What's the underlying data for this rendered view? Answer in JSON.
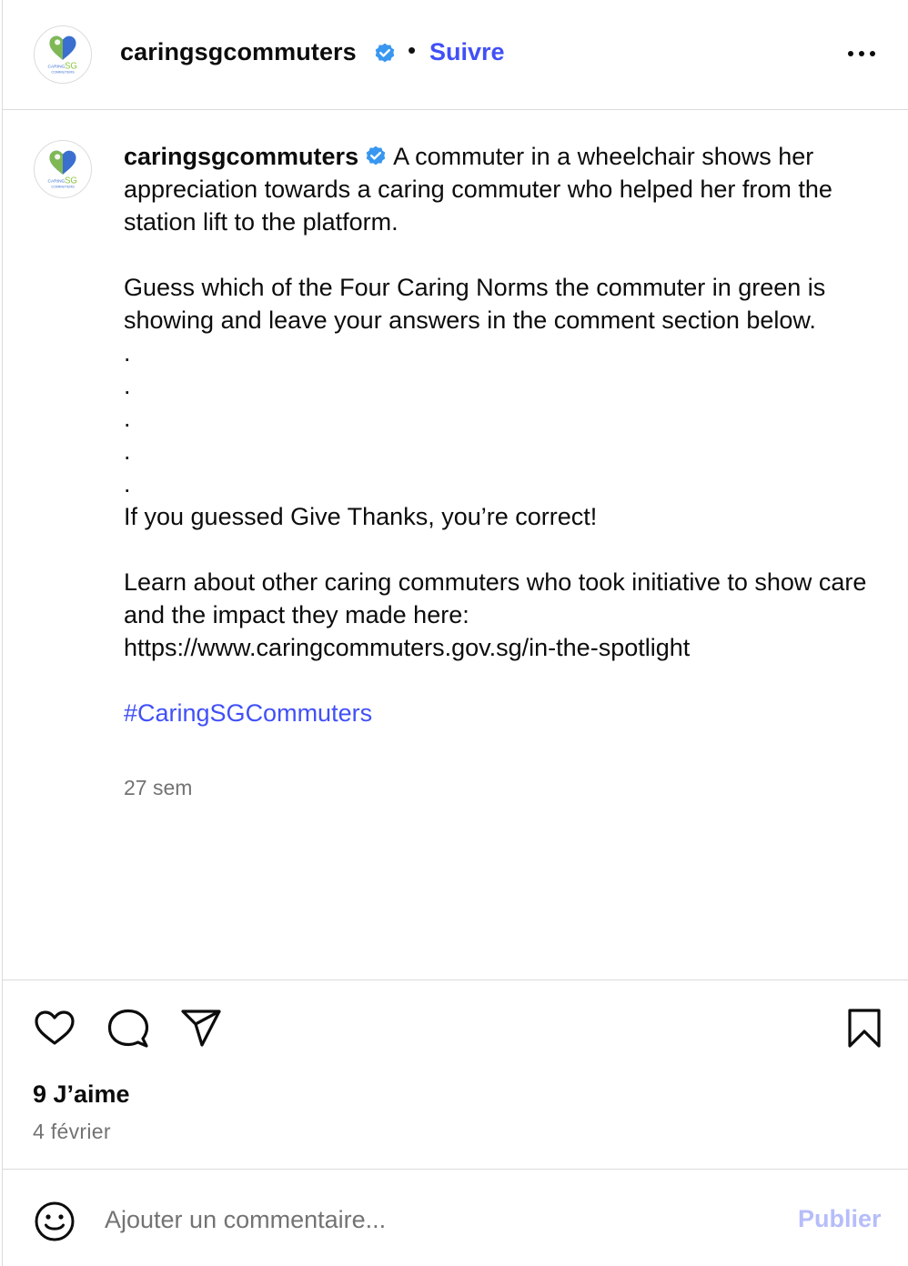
{
  "post": {
    "username": "caringsgcommuters",
    "follow_label": "Suivre",
    "separator": "•",
    "avatar_logo": {
      "line1": "CARING",
      "line2": "SG",
      "line3": "COMMUTERS",
      "heart_color": "#3a6fd0",
      "accent_color": "#8cc63f"
    },
    "verified_color": "#3897f0"
  },
  "caption": {
    "username": "caringsgcommuters",
    "text": "A commuter in a wheelchair shows her appreciation towards a caring commuter who helped her from the station lift to the platform.\n\nGuess which of the Four Caring Norms the commuter in green is showing and leave your answers in the comment section below.\n.\n.\n.\n.\n.\nIf you guessed Give Thanks, you’re correct!\n\nLearn about other caring commuters who took initiative to show care and the impact they made here: https://www.caringcommuters.gov.sg/in-the-spotlight\n\n",
    "hashtag": "#CaringSGCommuters",
    "time_ago": "27 sem"
  },
  "actions": {
    "icons": [
      "heart-icon",
      "comment-icon",
      "share-icon",
      "bookmark-icon"
    ],
    "likes": "9 J’aime",
    "date": "4 février"
  },
  "comment": {
    "placeholder": "Ajouter un commentaire...",
    "publish_label": "Publier"
  },
  "colors": {
    "link_blue": "#4150f7",
    "publish_disabled": "#b6bdfa",
    "secondary_text": "#737373",
    "divider": "#dbdbdb"
  }
}
